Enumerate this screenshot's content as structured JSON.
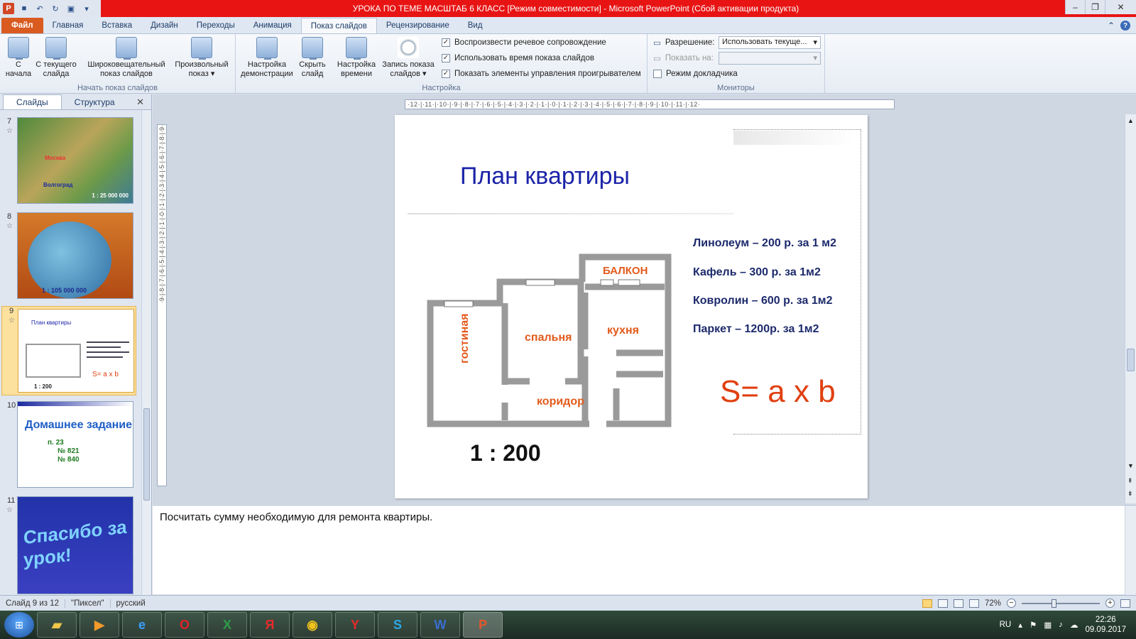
{
  "titlebar": {
    "title": "УРОКА ПО ТЕМЕ МАСШТАБ 6 КЛАСС  [Режим совместимости]  -  Microsoft PowerPoint (Сбой активации продукта)"
  },
  "tabs": [
    {
      "label": "Файл"
    },
    {
      "label": "Главная"
    },
    {
      "label": "Вставка"
    },
    {
      "label": "Дизайн"
    },
    {
      "label": "Переходы"
    },
    {
      "label": "Анимация"
    },
    {
      "label": "Показ слайдов"
    },
    {
      "label": "Рецензирование"
    },
    {
      "label": "Вид"
    }
  ],
  "ribbon": {
    "start_group": {
      "label": "Начать показ слайдов",
      "from_start": "С\nначала",
      "from_current": "С текущего\nслайда",
      "broadcast": "Широковещательный\nпоказ слайдов",
      "custom": "Произвольный\nпоказ ▾"
    },
    "setup_group": {
      "label": "Настройка",
      "setup_show": "Настройка\nдемонстрации",
      "hide_slide": "Скрыть\nслайд",
      "rehearse": "Настройка\nвремени",
      "record": "Запись показа\nслайдов ▾",
      "chk_narration": "Воспроизвести речевое сопровождение",
      "chk_timings": "Использовать время показа слайдов",
      "chk_controls": "Показать элементы управления проигрывателем"
    },
    "monitors_group": {
      "label": "Мониторы",
      "resolution_label": "Разрешение:",
      "resolution_value": "Использовать текуще...",
      "show_on_label": "Показать на:",
      "presenter_view": "Режим докладчика"
    }
  },
  "panel": {
    "tab_slides": "Слайды",
    "tab_outline": "Структура",
    "thumbs": [
      {
        "num": "7",
        "caption_a": "Москва",
        "caption_b": "Волгоград",
        "scale": "1 : 25 000 000"
      },
      {
        "num": "8",
        "scale": "1 : 105 000 000"
      },
      {
        "num": "9",
        "title": "План квартиры",
        "scale": "1 : 200",
        "formula": "S= a x b"
      },
      {
        "num": "10",
        "title": "Домашнее задание",
        "line1": "п. 23",
        "line2": "№ 821",
        "line3": "№ 840"
      },
      {
        "num": "11",
        "title": "Спасибо за урок!"
      }
    ]
  },
  "ruler": {
    "h": "·12·|·11·|·10·|·9·|·8·|·7·|·6·|·5·|·4·|·3·|·2·|·1·|·0·|·1·|·2·|·3·|·4·|·5·|·6·|·7·|·8·|·9·|·10·|·11·|·12·",
    "v": "·9·|·8·|·7·|·6·|·5·|·4·|·3·|·2·|·1·|·0·|·1·|·2·|·3·|·4·|·5·|·6·|·7·|·8·|·9·"
  },
  "slide": {
    "title": "План квартиры",
    "prices": [
      "Линолеум – 200 р. за 1 м2",
      "Кафель – 300 р. за 1м2",
      "Ковролин – 600 р. за 1м2",
      "Паркет – 1200р. за 1м2"
    ],
    "formula": "S= a x b",
    "scale": "1 : 200",
    "rooms": {
      "balcony": "БАЛКОН",
      "bedroom": "спальня",
      "kitchen": "кухня",
      "living": "гостиная",
      "corridor": "коридор"
    }
  },
  "notes": {
    "text": "Посчитать сумму необходимую для ремонта квартиры."
  },
  "status": {
    "slide_of": "Слайд 9 из 12",
    "theme": "\"Пиксел\"",
    "language": "русский",
    "zoom": "72%"
  },
  "taskbar": {
    "lang": "RU",
    "time": "22:26",
    "date": "09.09.2017"
  }
}
